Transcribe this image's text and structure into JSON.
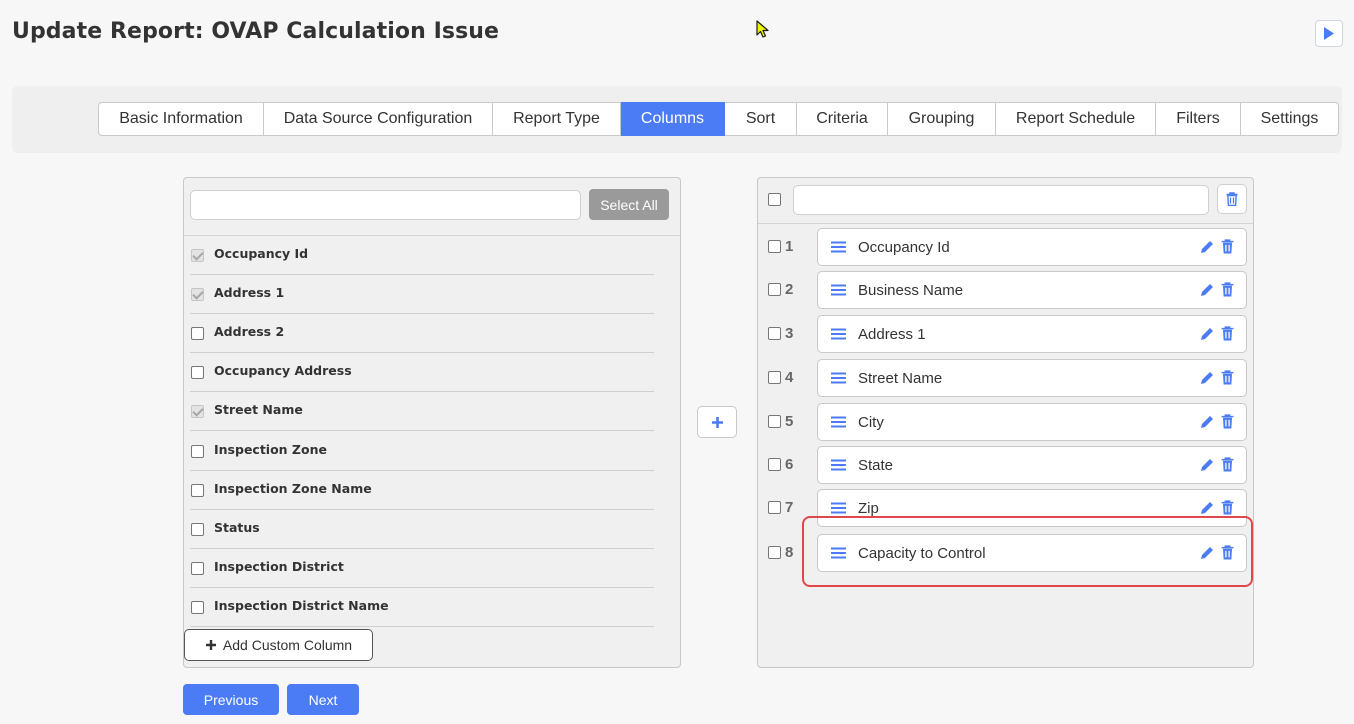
{
  "page": {
    "title": "Update Report: OVAP Calculation Issue"
  },
  "tabs": [
    {
      "label": "Basic Information",
      "active": false
    },
    {
      "label": "Data Source Configuration",
      "active": false
    },
    {
      "label": "Report Type",
      "active": false
    },
    {
      "label": "Columns",
      "active": true
    },
    {
      "label": "Sort",
      "active": false
    },
    {
      "label": "Criteria",
      "active": false
    },
    {
      "label": "Grouping",
      "active": false
    },
    {
      "label": "Report Schedule",
      "active": false
    },
    {
      "label": "Filters",
      "active": false
    },
    {
      "label": "Settings",
      "active": false
    }
  ],
  "available_columns": {
    "search_value": "",
    "select_all_label": "Select All",
    "items": [
      {
        "label": "Occupancy Id",
        "checked": true
      },
      {
        "label": "Address 1",
        "checked": true
      },
      {
        "label": "Address 2",
        "checked": false
      },
      {
        "label": "Occupancy Address",
        "checked": false
      },
      {
        "label": "Street Name",
        "checked": true
      },
      {
        "label": "Inspection Zone",
        "checked": false
      },
      {
        "label": "Inspection Zone Name",
        "checked": false
      },
      {
        "label": "Status",
        "checked": false
      },
      {
        "label": "Inspection District",
        "checked": false
      },
      {
        "label": "Inspection District Name",
        "checked": false
      }
    ],
    "add_custom_label": "Add Custom Column"
  },
  "selected_columns": {
    "search_value": "",
    "items": [
      {
        "num": "1",
        "label": "Occupancy Id"
      },
      {
        "num": "2",
        "label": "Business Name"
      },
      {
        "num": "3",
        "label": "Address 1"
      },
      {
        "num": "4",
        "label": "Street Name"
      },
      {
        "num": "5",
        "label": "City"
      },
      {
        "num": "6",
        "label": "State"
      },
      {
        "num": "7",
        "label": "Zip"
      },
      {
        "num": "8",
        "label": "Capacity to Control"
      }
    ]
  },
  "nav": {
    "previous_label": "Previous",
    "next_label": "Next"
  },
  "colors": {
    "accent": "#4b7bf5",
    "highlight": "#e0474c",
    "disabled_button": "#9a9a9a"
  },
  "icons": {
    "play": "play-icon",
    "trash": "trash-icon",
    "edit": "pencil-icon",
    "drag": "drag-handle-icon",
    "plus": "plus-icon"
  }
}
